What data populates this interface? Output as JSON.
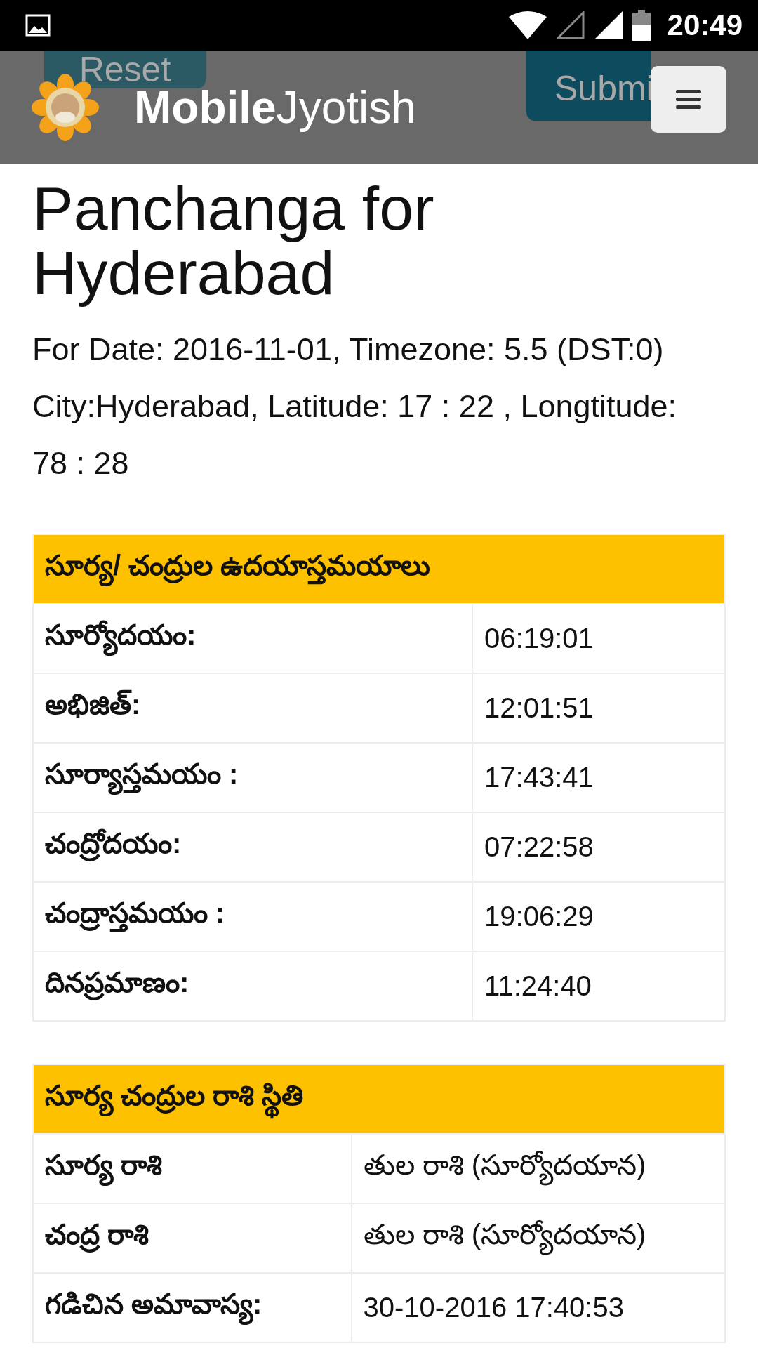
{
  "status_bar": {
    "time": "20:49"
  },
  "form_buttons": [
    {
      "label": "Reset",
      "kind": "reset"
    },
    {
      "label": "Submi",
      "kind": "submit"
    }
  ],
  "header": {
    "brand_bold": "Mobile",
    "brand_rest": "Jyotish"
  },
  "title": "Panchanga for Hyderabad",
  "info": [
    "For Date: 2016-11-01, Timezone: 5.5 (DST:0)",
    "City:Hyderabad, Latitude: 17 : 22 , Longtitude: 78 : 28"
  ],
  "tables": [
    {
      "heading": "సూర్య/ చంద్రుల ఉదయాస్తమయాలు",
      "rows": [
        {
          "label": "సూర్యోదయం:",
          "value": "06:19:01"
        },
        {
          "label": "అభిజిత్:",
          "value": "12:01:51"
        },
        {
          "label": "సూర్యాస్తమయం :",
          "value": "17:43:41"
        },
        {
          "label": "చంద్రోదయం:",
          "value": "07:22:58"
        },
        {
          "label": "చంద్రాస్తమయం :",
          "value": "19:06:29"
        },
        {
          "label": "దినప్రమాణం:",
          "value": "11:24:40"
        }
      ]
    },
    {
      "heading": "సూర్య చంద్రుల రాశి స్థితి",
      "rows": [
        {
          "label": "సూర్య రాశి",
          "value": "తుల రాశి (సూర్యోదయాన)"
        },
        {
          "label": "చంద్ర రాశి",
          "value": "తుల రాశి (సూర్యోదయాన)"
        },
        {
          "label": "గడిచిన అమావాస్య:",
          "value": "30-10-2016 17:40:53"
        }
      ]
    }
  ]
}
